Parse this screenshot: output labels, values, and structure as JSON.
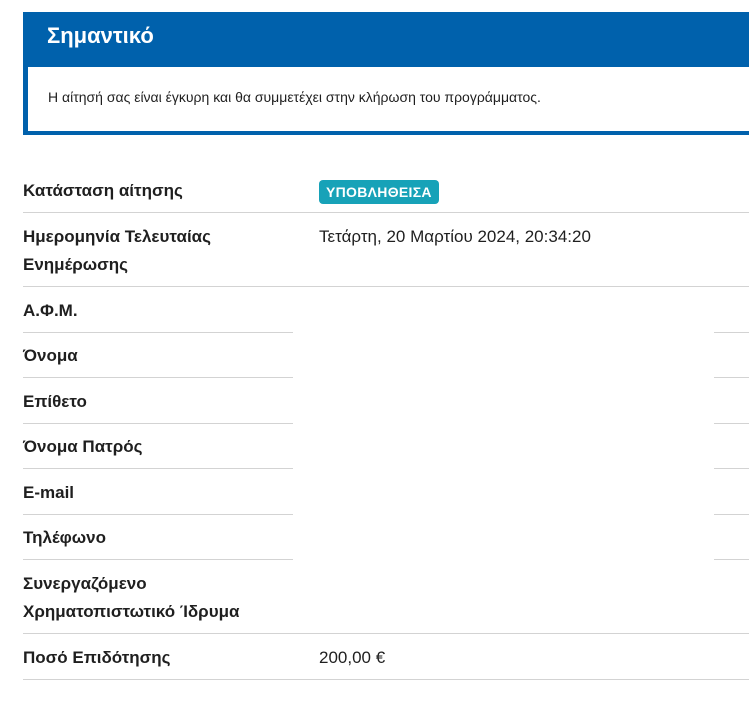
{
  "notice": {
    "title": "Σημαντικό",
    "message": "Η αίτησή σας είναι έγκυρη και θα συμμετέχει στην κλήρωση του προγράμματος."
  },
  "details": {
    "status_label": "Κατάσταση αίτησης",
    "status_value": "ΥΠΟΒΛΗΘΕΙΣΑ",
    "last_update_label_line1": "Ημερομηνία Τελευταίας",
    "last_update_label_line2": "Ενημέρωσης",
    "last_update_value": "Τετάρτη, 20 Μαρτίου 2024, 20:34:20",
    "afm_label": "Α.Φ.Μ.",
    "first_name_label": "Όνομα",
    "last_name_label": "Επίθετο",
    "father_name_label": "Όνομα Πατρός",
    "email_label": "E-mail",
    "phone_label": "Τηλέφωνο",
    "bank_label_line1": "Συνεργαζόμενο",
    "bank_label_line2": "Χρηματοπιστωτικό Ίδρυμα",
    "amount_label": "Ποσό Επιδότησης",
    "amount_value": "200,00 €"
  },
  "colors": {
    "primary": "#0061ac",
    "badge": "#17a2b8",
    "divider": "#d3d3d3"
  }
}
